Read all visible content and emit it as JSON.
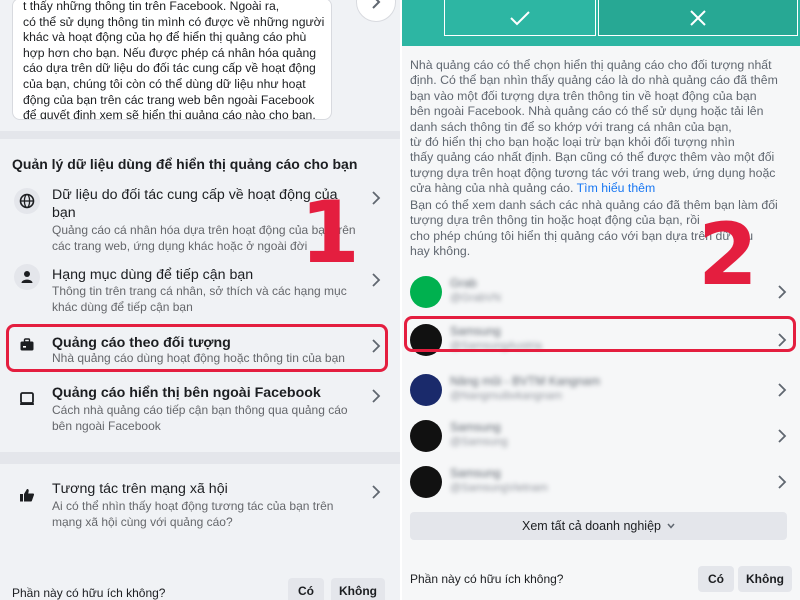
{
  "left": {
    "textbox_lines": [
      "t thấy những thông tin trên Facebook. Ngoài ra,",
      "có thể sử dụng thông tin mình có được về những người",
      "khác và hoạt động của họ để hiển thị quảng cáo phù",
      "hợp hơn cho bạn. Nếu được phép cá nhân hóa quảng",
      "cáo dựa trên dữ liệu do đối tác cung cấp về hoạt động",
      "của bạn, chúng tôi còn có thể dùng dữ liệu như hoạt",
      "động của bạn trên các trang web bên ngoài Facebook",
      "để quyết định xem sẽ hiển thị quảng cáo nào cho bạn."
    ],
    "section_title": "Quản lý dữ liệu dùng để hiển thị quảng cáo cho bạn",
    "items": [
      {
        "icon": "globe-icon",
        "title_lines": [
          "Dữ liệu do đối tác cung cấp về hoạt động của",
          "bạn"
        ],
        "desc_lines": [
          "Quảng cáo cá nhân hóa dựa trên hoạt động của bạn trên",
          "các trang web, ứng dụng khác hoặc ở ngoài đời"
        ]
      },
      {
        "icon": "person-icon",
        "title_lines": [
          "Hạng mục dùng để tiếp cận bạn"
        ],
        "desc_lines": [
          "Thông tin trên trang cá nhân, sở thích và các hạng mục",
          "khác dùng để tiếp cận bạn"
        ]
      },
      {
        "icon": "briefcase-icon",
        "title_lines": [
          "Quảng cáo theo đối tượng"
        ],
        "desc_lines": [
          "Nhà quảng cáo dùng hoạt động hoặc thông tin của bạn"
        ]
      },
      {
        "icon": "laptop-icon",
        "title_lines": [
          "Quảng cáo hiển thị bên ngoài Facebook"
        ],
        "desc_lines": [
          "Cách nhà quảng cáo tiếp cận bạn thông qua quảng cáo",
          "bên ngoài Facebook"
        ]
      },
      {
        "icon": "thumbs-up-icon",
        "title_lines": [
          "Tương tác trên mạng xã hội"
        ],
        "desc_lines": [
          "Ai có thể nhìn thấy hoạt động tương tác của bạn trên",
          "mạng xã hội cùng với quảng cáo?"
        ]
      }
    ],
    "annotation_number": "1",
    "footer_question": "Phần này có hữu ích không?",
    "yes_label": "Có",
    "no_label": "Không"
  },
  "right": {
    "paragraph1_lines": [
      "Nhà quảng cáo có thể chọn hiển thị quảng cáo cho đối tượng nhất",
      "định. Có thể bạn nhìn thấy quảng cáo là do nhà quảng cáo đã thêm",
      "bạn vào một đối tượng dựa trên thông tin về hoạt động của bạn",
      "bên ngoài Facebook. Nhà quảng cáo có thể sử dụng hoặc tải lên",
      "danh sách thông tin để so khớp với trang cá nhân của bạn,",
      "từ đó hiển thị cho bạn hoặc loại trừ bạn khỏi đối tượng nhìn",
      "thấy quảng cáo nhất định. Bạn cũng có thể được thêm vào một đối",
      "tượng dựa trên hoạt động tương tác với trang web, ứng dụng hoặc",
      "cửa hàng của nhà quảng cáo."
    ],
    "learn_more": "Tìm hiểu thêm",
    "paragraph2_lines": [
      "Bạn có thể xem danh sách các nhà quảng cáo đã thêm bạn làm đối",
      "tượng dựa trên thông tin hoặc hoạt động của bạn, rồi",
      "cho phép chúng tôi hiển thị quảng cáo với bạn dựa trên dữ liệu",
      "hay không."
    ],
    "advertisers": [
      {
        "name": "Grab",
        "handle": "@GrabVN",
        "color": "#00b14f"
      },
      {
        "name": "Samsung",
        "handle": "@SamsungAustria",
        "color": "#111111"
      },
      {
        "name": "Nâng mũi - BVTM Kangnam",
        "handle": "@Nangmuibvkangnam",
        "color": "#1a2a6b"
      },
      {
        "name": "Samsung",
        "handle": "@Samsung",
        "color": "#111111"
      },
      {
        "name": "Samsung",
        "handle": "@SamsungVietnam",
        "color": "#111111"
      }
    ],
    "see_all": "Xem tất cả doanh nghiệp",
    "annotation_number": "2",
    "footer_question": "Phần này có hữu ích không?",
    "yes_label": "Có",
    "no_label": "Không"
  },
  "colors": {
    "highlight": "#e41e3f",
    "link": "#1877f2",
    "accent_teal": "#2db6a3"
  }
}
